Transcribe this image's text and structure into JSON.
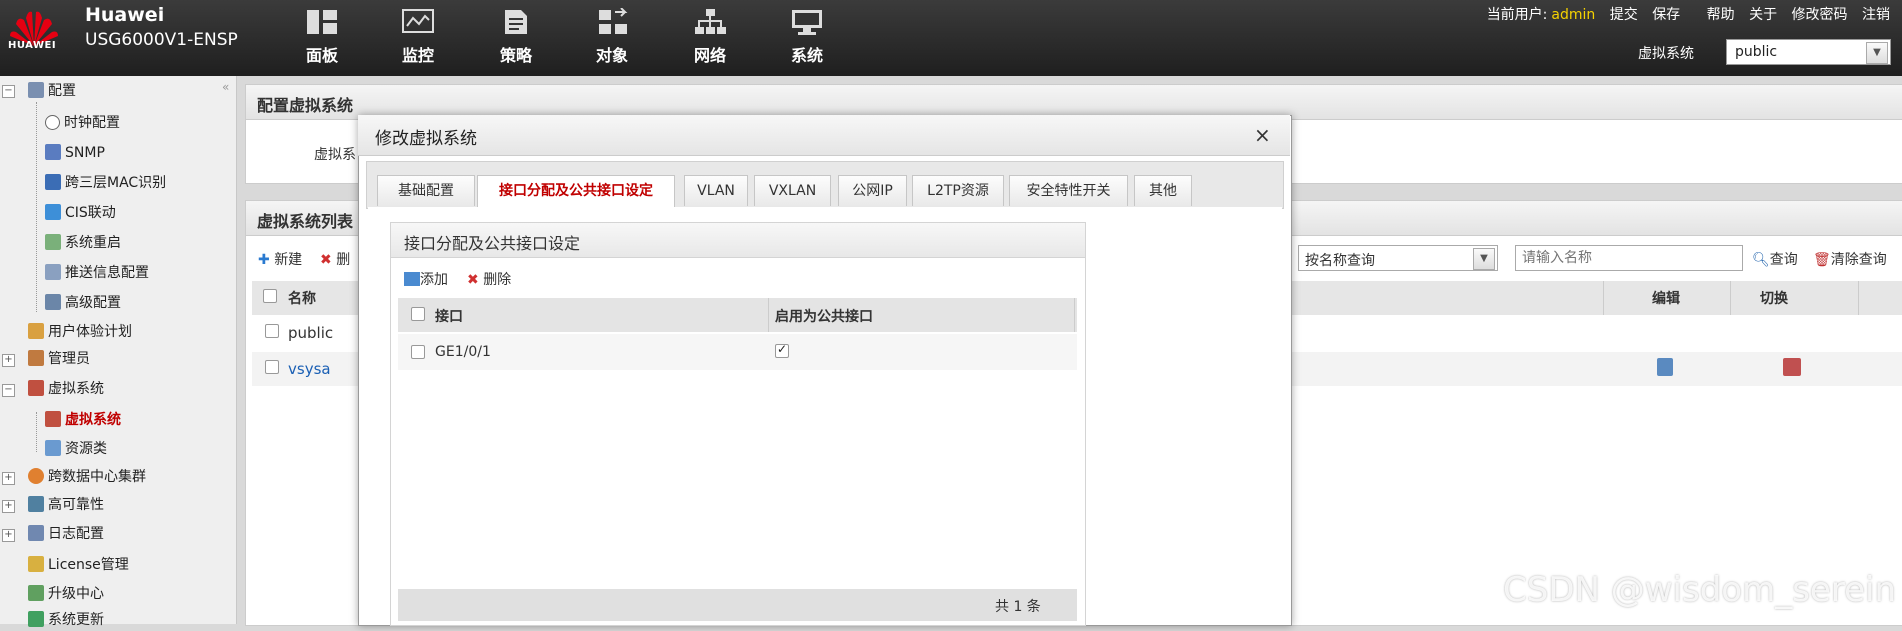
{
  "header": {
    "logo_text": "HUAWEI",
    "brand": "Huawei",
    "model": "USG6000V1-ENSP",
    "nav": [
      "面板",
      "监控",
      "策略",
      "对象",
      "网络",
      "系统"
    ],
    "user_label": "当前用户:",
    "user_name": "admin",
    "links": [
      "提交",
      "保存",
      "帮助",
      "关于",
      "修改密码",
      "注销"
    ],
    "vsys_label": "虚拟系统",
    "vsys_value": "public"
  },
  "sidebar": {
    "items": [
      "配置",
      "时钟配置",
      "SNMP",
      "跨三层MAC识别",
      "CIS联动",
      "系统重启",
      "推送信息配置",
      "高级配置",
      "用户体验计划",
      "管理员",
      "虚拟系统",
      "虚拟系统",
      "资源类",
      "跨数据中心集群",
      "高可靠性",
      "日志配置",
      "License管理",
      "升级中心",
      "系统更新"
    ]
  },
  "main": {
    "panel1_title": "配置虚拟系统",
    "panel1_label": "虚拟系",
    "panel2_title": "虚拟系统列表",
    "toolbar": {
      "new": "新建",
      "delete": "删"
    },
    "search_select": "按名称查询",
    "search_placeholder": "请输入名称",
    "search_btn": "查询",
    "clear_btn": "清除查询",
    "columns": {
      "name": "名称",
      "edit": "编辑",
      "switch": "切换"
    },
    "rows": [
      "public",
      "vsysa"
    ]
  },
  "modal": {
    "title": "修改虚拟系统",
    "close": "×",
    "tabs": [
      "基础配置",
      "接口分配及公共接口设定",
      "VLAN",
      "VXLAN",
      "公网IP",
      "L2TP资源",
      "安全特性开关",
      "其他"
    ],
    "selected_tab": 1,
    "section_title": "接口分配及公共接口设定",
    "add": "添加",
    "delete": "删除",
    "columns": [
      "接口",
      "启用为公共接口"
    ],
    "rows": [
      {
        "interface": "GE1/0/1",
        "public": true
      }
    ],
    "total": "共 1 条"
  },
  "watermark": "CSDN @wisdom_serein",
  "colors": {
    "accent_red": "#c00000",
    "admin_yellow": "#f5d200",
    "link_blue": "#1a5fb4"
  }
}
